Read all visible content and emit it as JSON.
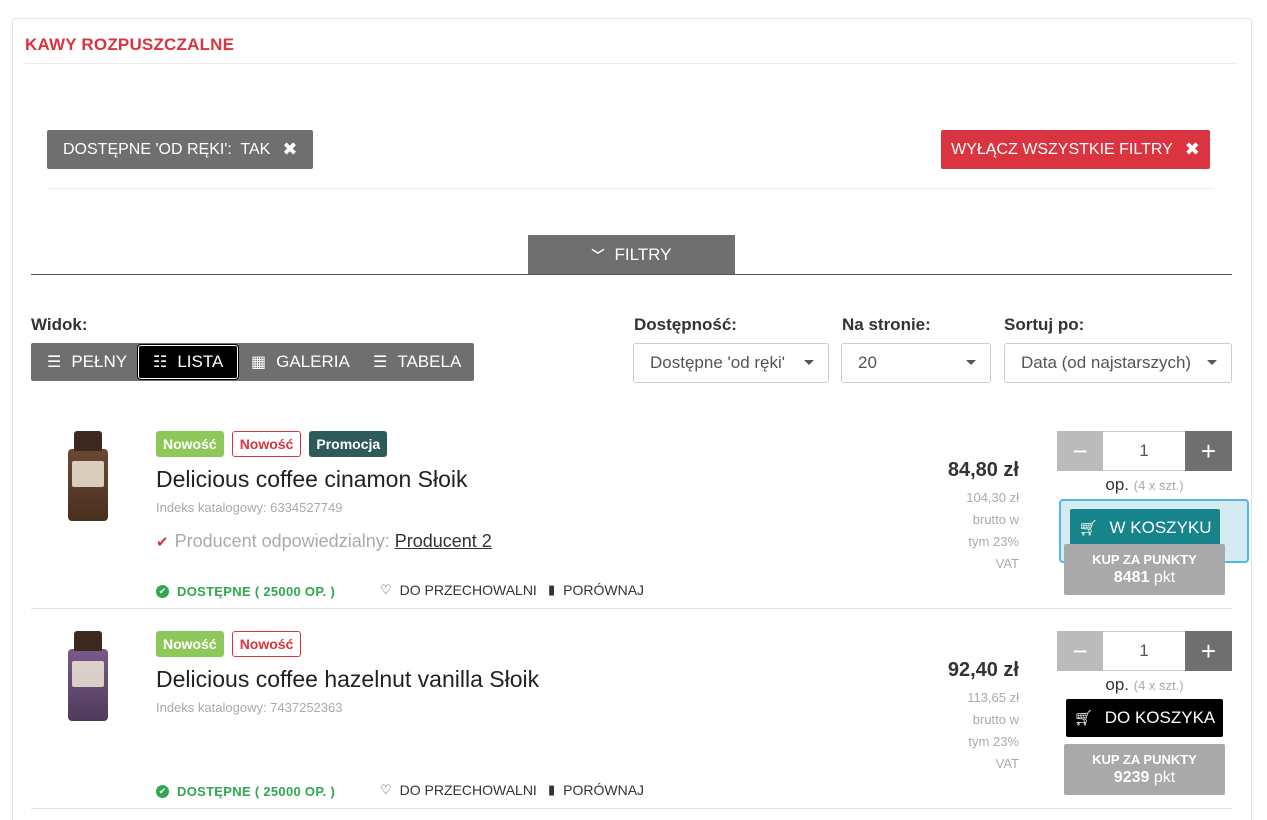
{
  "category_title": "KAWY ROZPUSZCZALNE",
  "active_filter": {
    "label": "DOSTĘPNE 'OD RĘKI':  TAK",
    "remove_icon": "close-icon"
  },
  "clear_filters": {
    "label": "WYŁĄCZ WSZYSTKIE FILTRY",
    "icon": "close-icon"
  },
  "filters_toggle": {
    "label": "FILTRY",
    "icon": "chevron-down-icon"
  },
  "view": {
    "label": "Widok:",
    "options": [
      {
        "label": "PEŁNY",
        "icon": "full-list-icon",
        "active": false
      },
      {
        "label": "LISTA",
        "icon": "list-icon",
        "active": true
      },
      {
        "label": "GALERIA",
        "icon": "grid-icon",
        "active": false
      },
      {
        "label": "TABELA",
        "icon": "table-icon",
        "active": false
      }
    ]
  },
  "availability": {
    "label": "Dostępność:",
    "selected": "Dostępne 'od ręki'"
  },
  "per_page": {
    "label": "Na stronie:",
    "selected": "20"
  },
  "sort": {
    "label": "Sortuj po:",
    "selected": "Data (od najstarszych)"
  },
  "products": [
    {
      "badges": [
        "Nowość",
        "Nowość",
        "Promocja"
      ],
      "name": "Delicious coffee cinamon Słoik",
      "index": "Indeks katalogowy: 6334527749",
      "producer_label": "Producent odpowiedzialny:",
      "producer_name": "Producent 2",
      "availability": "DOSTĘPNE ( 25000 OP. )",
      "store_label": "DO PRZECHOWALNI",
      "compare_label": "PORÓWNAJ",
      "price": "84,80 zł",
      "gross_lines": [
        "104,30 zł",
        "brutto w",
        "tym 23%",
        "VAT"
      ],
      "quantity": "1",
      "unit": "op.",
      "unit_detail": "(4 x szt.)",
      "cart_label": "W KOSZYKU",
      "points_label": "KUP ZA PUNKTY",
      "points_value": "8481",
      "points_unit": "pkt",
      "in_cart": true
    },
    {
      "badges": [
        "Nowość",
        "Nowość"
      ],
      "name": "Delicious coffee hazelnut vanilla Słoik",
      "index": "Indeks katalogowy: 7437252363",
      "availability": "DOSTĘPNE ( 25000 OP. )",
      "store_label": "DO PRZECHOWALNI",
      "compare_label": "PORÓWNAJ",
      "price": "92,40 zł",
      "gross_lines": [
        "113,65 zł",
        "brutto w",
        "tym 23%",
        "VAT"
      ],
      "quantity": "1",
      "unit": "op.",
      "unit_detail": "(4 x szt.)",
      "cart_label": "DO KOSZYKA",
      "points_label": "KUP ZA PUNKTY",
      "points_value": "9239",
      "points_unit": "pkt",
      "in_cart": false
    }
  ],
  "colors": {
    "accent_red": "#d9343f",
    "teal": "#16848a",
    "green": "#2fa84f",
    "badge_green": "#8fc85a",
    "badge_dark": "#2f5a5c"
  }
}
